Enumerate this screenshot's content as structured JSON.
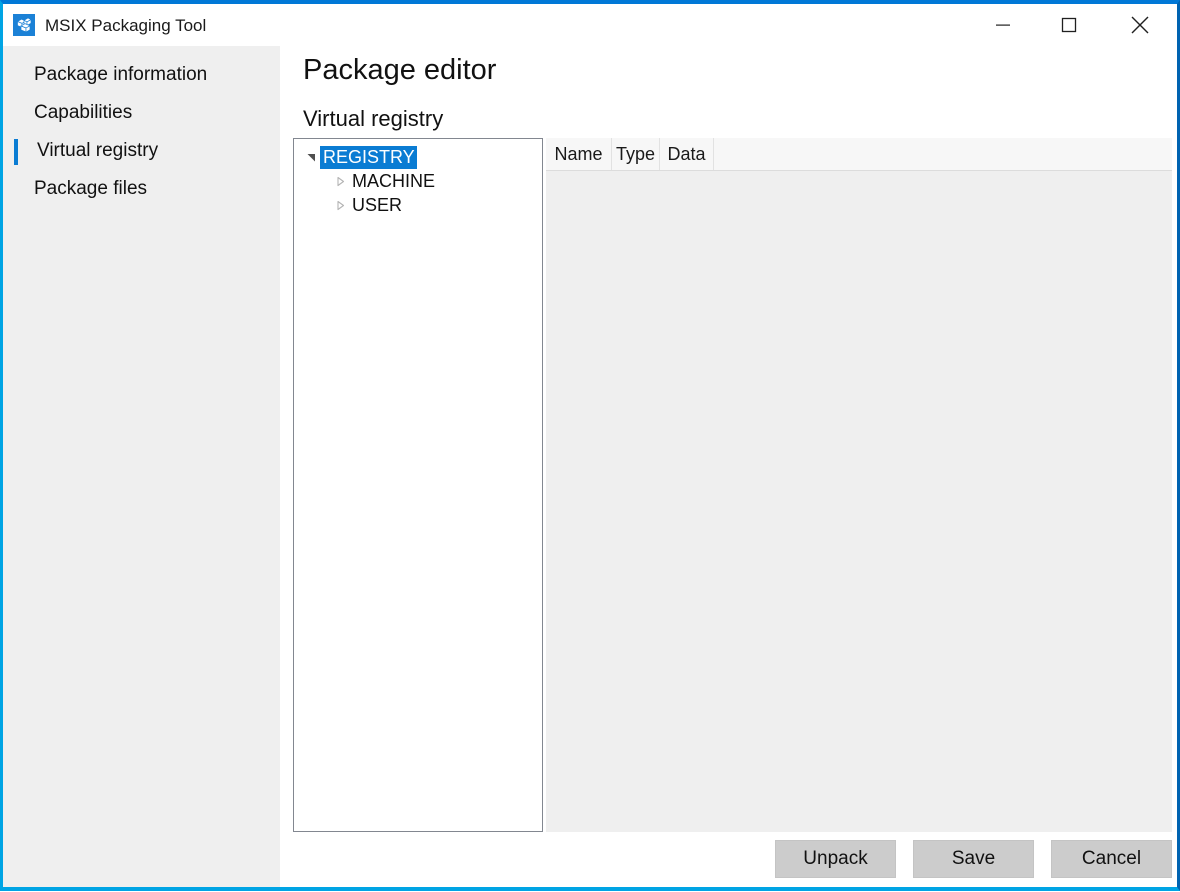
{
  "window": {
    "title": "MSIX Packaging Tool",
    "app_icon": "package-box-icon",
    "accent_top": "#0078d7",
    "accent_side": "#00a4e4",
    "controls": {
      "minimize": "minimize-icon",
      "maximize": "maximize-icon",
      "close": "close-icon"
    }
  },
  "sidebar": {
    "items": [
      {
        "label": "Package information",
        "selected": false
      },
      {
        "label": "Capabilities",
        "selected": false
      },
      {
        "label": "Virtual registry",
        "selected": true
      },
      {
        "label": "Package files",
        "selected": false
      }
    ],
    "accent_color": "#0a7cd3"
  },
  "main": {
    "page_title": "Package editor",
    "section_title": "Virtual registry"
  },
  "tree": {
    "nodes": [
      {
        "label": "REGISTRY",
        "level": 1,
        "expanded": true,
        "selected": true,
        "glyph": "triangle-expanded-icon"
      },
      {
        "label": "MACHINE",
        "level": 2,
        "expanded": false,
        "selected": false,
        "glyph": "triangle-collapsed-icon"
      },
      {
        "label": "USER",
        "level": 2,
        "expanded": false,
        "selected": false,
        "glyph": "triangle-collapsed-icon"
      }
    ],
    "selection_color": "#0a7cd3"
  },
  "list": {
    "columns": [
      "Name",
      "Type",
      "Data"
    ],
    "rows": []
  },
  "footer": {
    "buttons": [
      {
        "label": "Unpack"
      },
      {
        "label": "Save"
      },
      {
        "label": "Cancel"
      }
    ]
  }
}
